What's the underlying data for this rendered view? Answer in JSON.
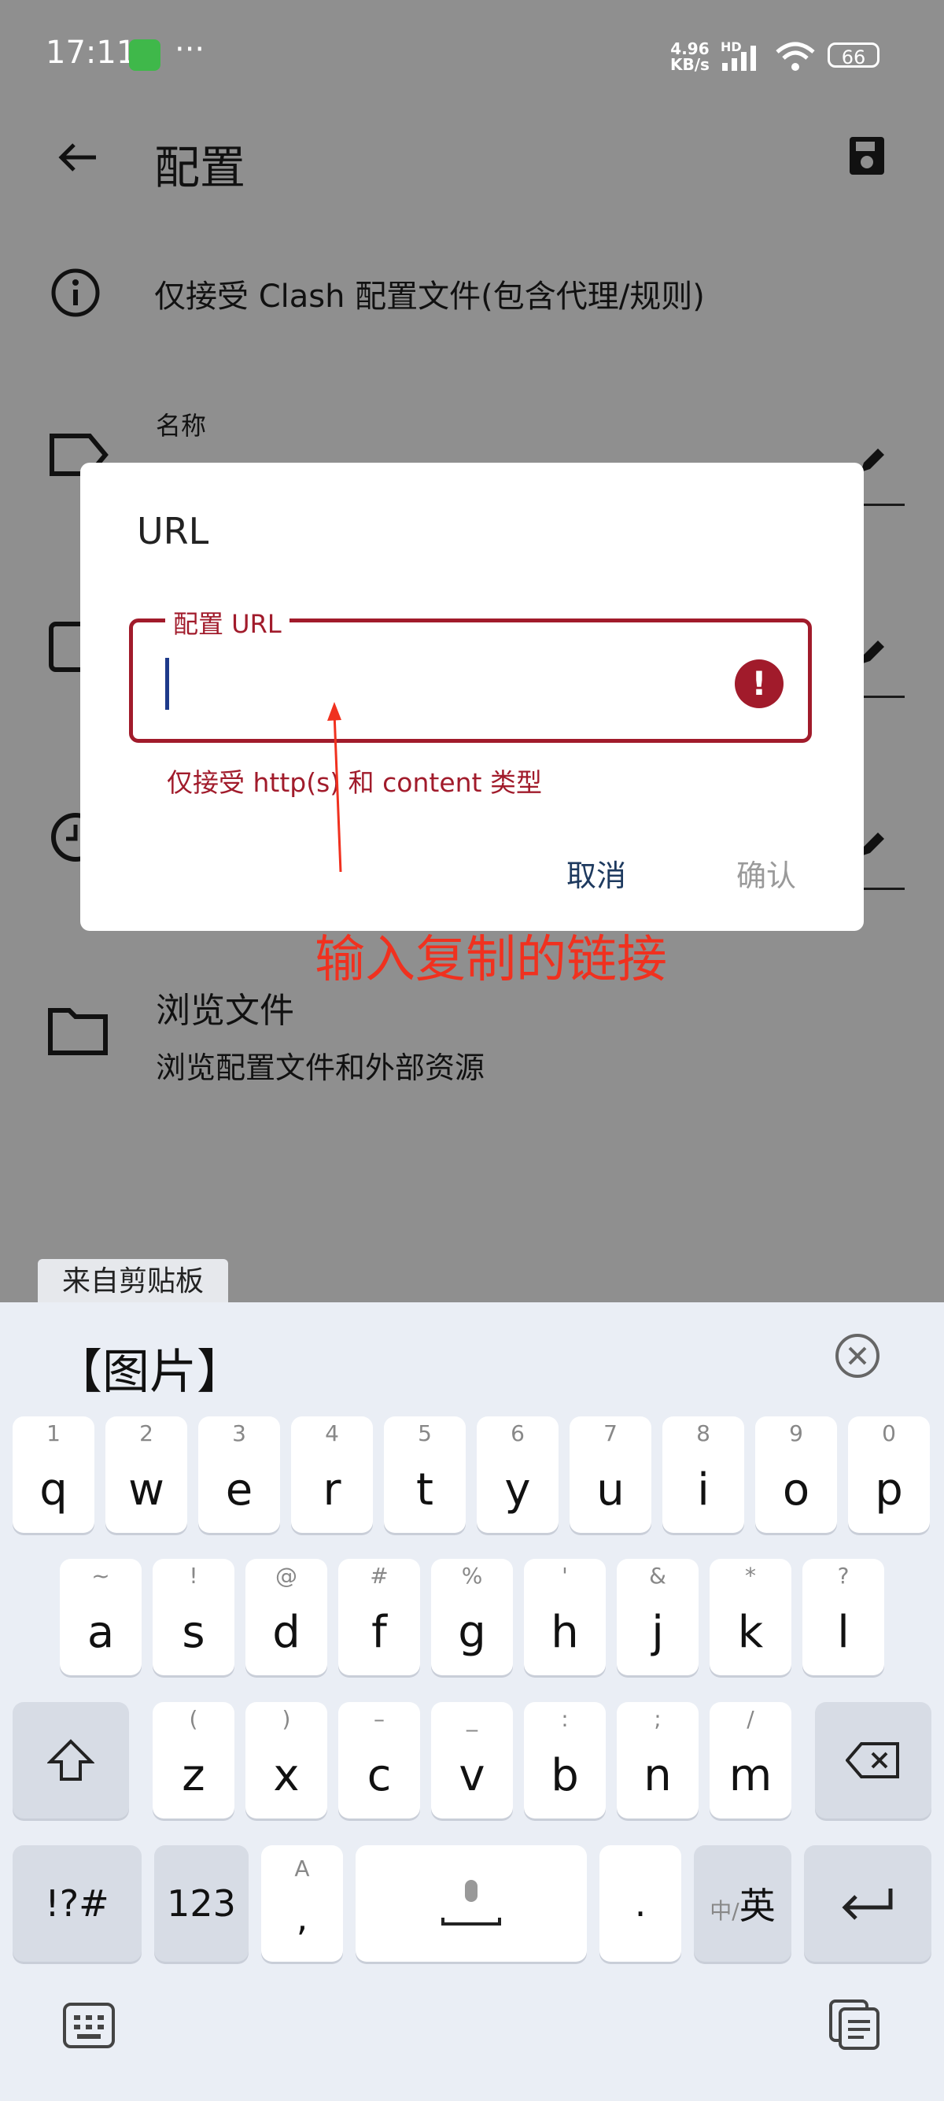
{
  "status_bar": {
    "time": "17:11",
    "dots": "···",
    "speed_top": "4.96",
    "speed_bottom": "KB/s",
    "hd": "HD",
    "battery": "66"
  },
  "toolbar": {
    "title": "配置"
  },
  "info": {
    "text": "仅接受 Clash 配置文件(包含代理/规则)"
  },
  "name_row": {
    "label": "名称"
  },
  "browse_row": {
    "title": "浏览文件",
    "subtitle": "浏览配置文件和外部资源"
  },
  "dialog": {
    "title": "URL",
    "field_label": "配置 URL",
    "field_value": "",
    "helper": "仅接受 http(s) 和 content 类型",
    "cancel": "取消",
    "confirm": "确认"
  },
  "annotation": "输入复制的链接",
  "keyboard": {
    "clipboard_chip": "来自剪贴板",
    "suggestion": "【图片】",
    "row1": [
      {
        "k": "q",
        "h": "1"
      },
      {
        "k": "w",
        "h": "2"
      },
      {
        "k": "e",
        "h": "3"
      },
      {
        "k": "r",
        "h": "4"
      },
      {
        "k": "t",
        "h": "5"
      },
      {
        "k": "y",
        "h": "6"
      },
      {
        "k": "u",
        "h": "7"
      },
      {
        "k": "i",
        "h": "8"
      },
      {
        "k": "o",
        "h": "9"
      },
      {
        "k": "p",
        "h": "0"
      }
    ],
    "row2": [
      {
        "k": "a",
        "h": "~"
      },
      {
        "k": "s",
        "h": "!"
      },
      {
        "k": "d",
        "h": "@"
      },
      {
        "k": "f",
        "h": "#"
      },
      {
        "k": "g",
        "h": "%"
      },
      {
        "k": "h",
        "h": "'"
      },
      {
        "k": "j",
        "h": "&"
      },
      {
        "k": "k",
        "h": "*"
      },
      {
        "k": "l",
        "h": "?"
      }
    ],
    "row3": [
      {
        "k": "z",
        "h": "("
      },
      {
        "k": "x",
        "h": ")"
      },
      {
        "k": "c",
        "h": "–"
      },
      {
        "k": "v",
        "h": "_"
      },
      {
        "k": "b",
        "h": ":"
      },
      {
        "k": "n",
        "h": ";"
      },
      {
        "k": "m",
        "h": "/"
      }
    ],
    "symbols": "!?#",
    "numbers": "123",
    "comma": ",",
    "comma_hint": "A",
    "period": ".",
    "lang_small": "中/",
    "lang_big": "英"
  },
  "colors": {
    "error": "#a11b2b",
    "annotation": "#f0311f",
    "primary_button": "#1e3a5f"
  }
}
